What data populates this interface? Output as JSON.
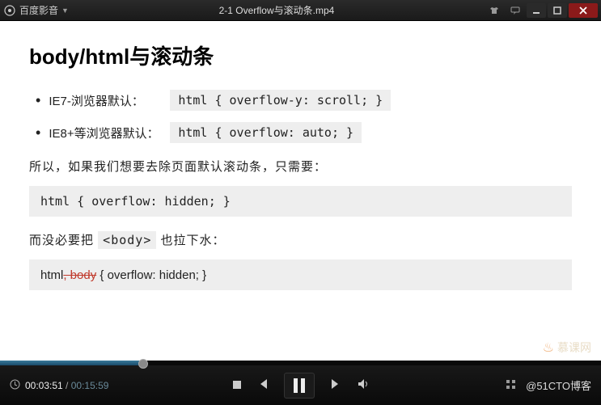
{
  "titlebar": {
    "app_name": "百度影音",
    "file_title": "2-1 Overflow与滚动条.mp4"
  },
  "content": {
    "heading": "body/html与滚动条",
    "bullets": [
      {
        "label": "IE7-浏览器默认：",
        "code": "html { overflow-y: scroll; }"
      },
      {
        "label": "IE8+等浏览器默认：",
        "code": "html { overflow: auto; }"
      }
    ],
    "para1": "所以，如果我们想要去除页面默认滚动条，只需要：",
    "code1": "html { overflow: hidden; }",
    "para2_pre": "而没必要把 ",
    "para2_tag": "<body>",
    "para2_post": " 也拉下水：",
    "code2_pre": "html",
    "code2_strike": ", body",
    "code2_post": " { overflow: hidden; }",
    "watermark": "慕课网"
  },
  "player": {
    "current_time": "00:03:51",
    "duration": "00:15:59",
    "attribution": "@51CTO博客"
  }
}
